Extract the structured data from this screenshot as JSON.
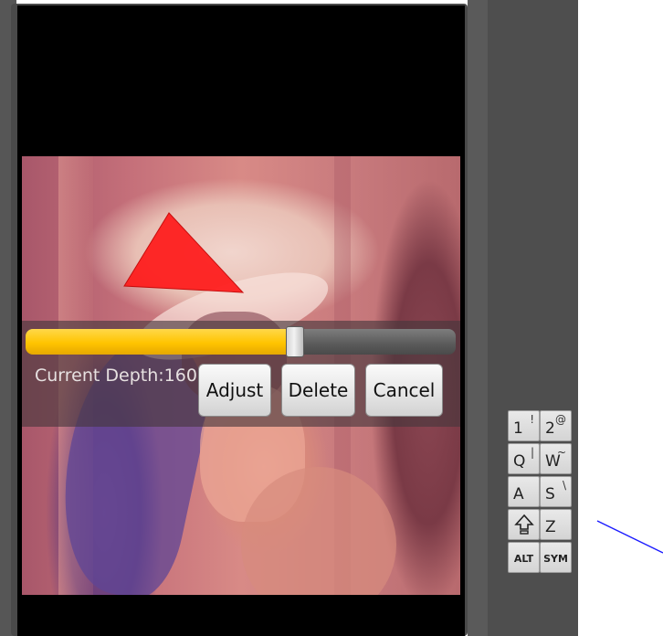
{
  "editor": {
    "depth_label": "Current Depth:160",
    "depth_fraction": 0.627,
    "shape_color": "#ff1a1a",
    "accent_color": "#ffc400",
    "buttons": {
      "adjust": "Adjust",
      "delete": "Delete",
      "cancel": "Cancel"
    }
  },
  "keyboard": {
    "rows": [
      [
        {
          "main": "1",
          "alt": "!"
        },
        {
          "main": "2",
          "alt": "@"
        }
      ],
      [
        {
          "main": "Q",
          "alt": "|"
        },
        {
          "main": "W",
          "alt": "~"
        }
      ],
      [
        {
          "main": "A",
          "alt": ""
        },
        {
          "main": "S",
          "alt": "\\"
        }
      ],
      [
        {
          "main": "",
          "alt": "",
          "icon": "shift-icon"
        },
        {
          "main": "Z",
          "alt": ""
        }
      ],
      [
        {
          "main": "ALT",
          "alt": ""
        },
        {
          "main": "SYM",
          "alt": ""
        }
      ]
    ]
  }
}
